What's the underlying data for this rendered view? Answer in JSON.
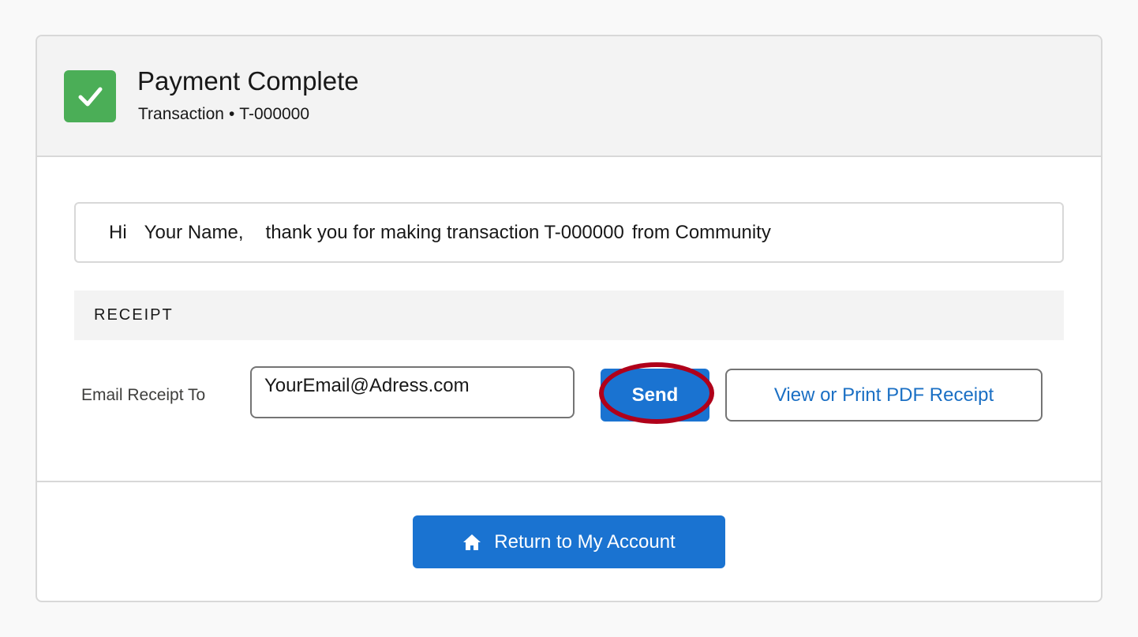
{
  "header": {
    "title": "Payment Complete",
    "subtitle_type": "Transaction",
    "subtitle_separator": "•",
    "subtitle_id": "T-000000",
    "status_icon": "checkmark-icon",
    "status_color": "#4bae57"
  },
  "greeting": {
    "hi": "Hi",
    "name": "Your Name,",
    "message": "thank you for making transaction",
    "transaction_id": "T-000000",
    "source": "from Community"
  },
  "receipt": {
    "section_title": "RECEIPT",
    "email_label": "Email Receipt To",
    "email_value": "YourEmail@Adress.com",
    "send_label": "Send",
    "pdf_label": "View or Print PDF Receipt"
  },
  "footer": {
    "return_label": "Return to My Account",
    "return_icon": "home-icon"
  },
  "colors": {
    "primary": "#1a73d1",
    "success": "#4bae57",
    "highlight": "#b0001a"
  }
}
